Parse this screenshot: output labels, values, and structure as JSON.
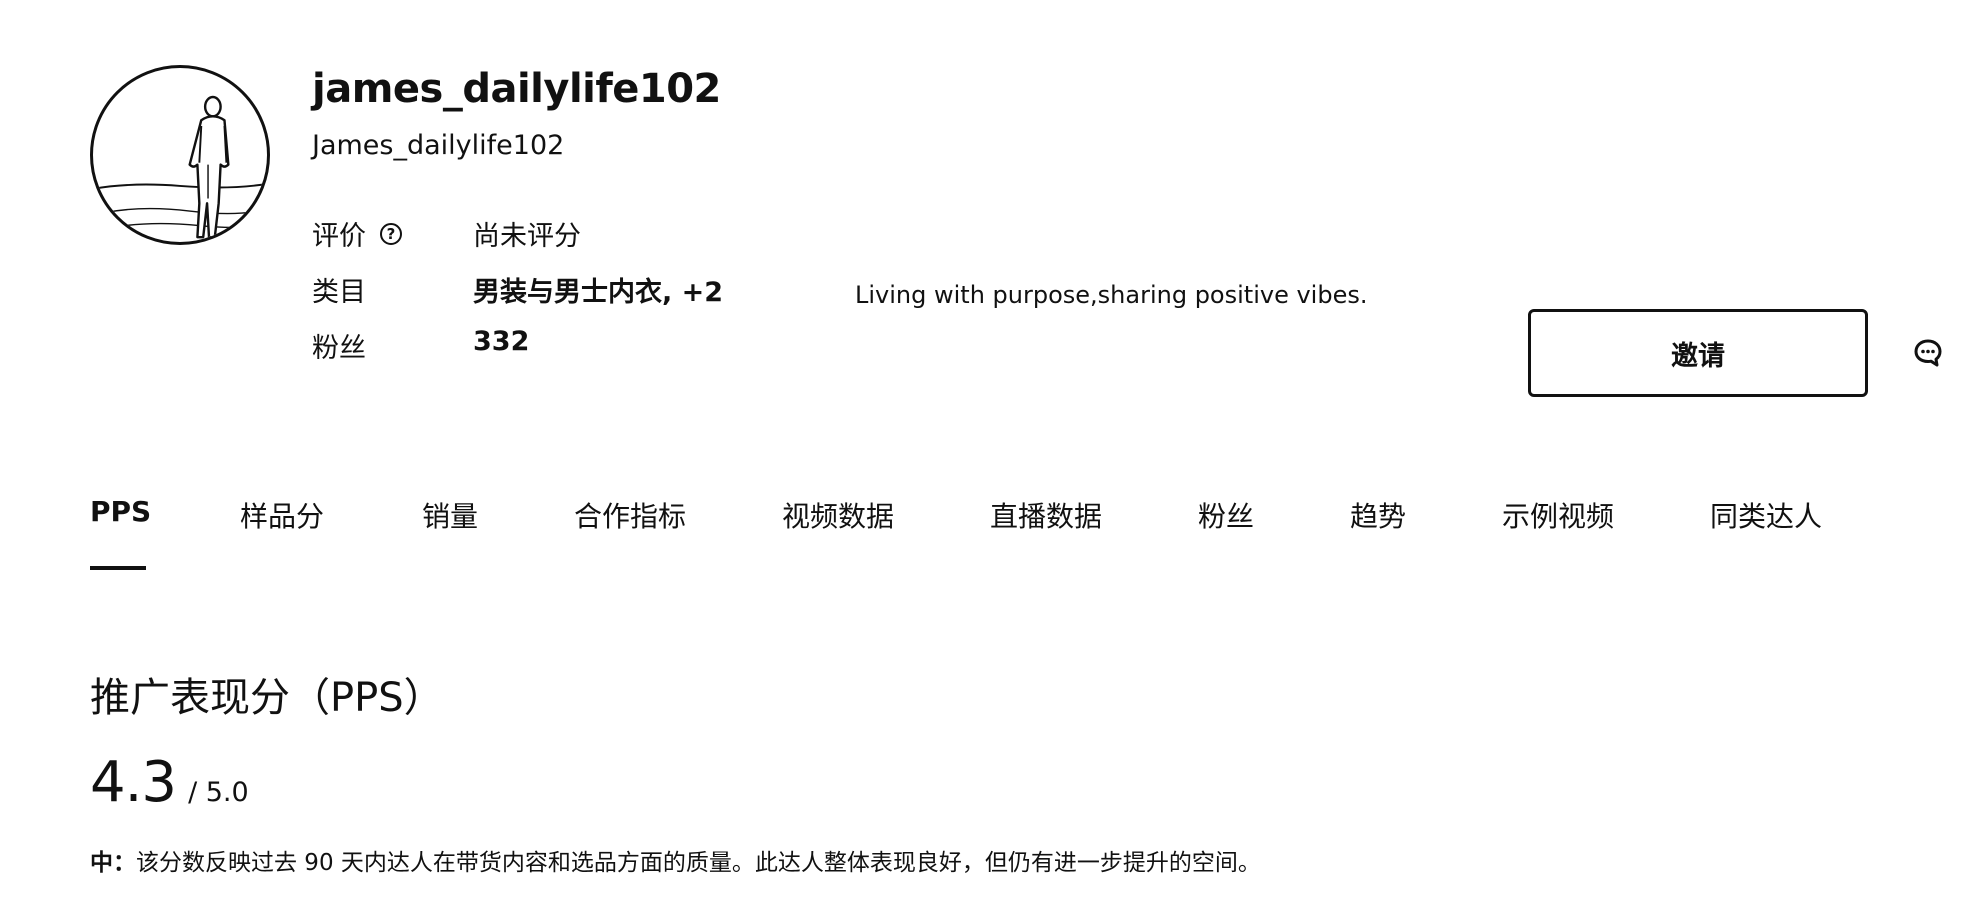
{
  "profile": {
    "username": "james_dailylife102",
    "handle": "James_dailylife102",
    "avatar_icon": "person-silhouette-avatar",
    "bio": "Living with purpose,sharing positive vibes."
  },
  "stats": {
    "rating_label": "评价",
    "rating_help_icon": "?",
    "rating_value": "尚未评分",
    "category_label": "类目",
    "category_value": "男装与男士内衣, +2",
    "fans_label": "粉丝",
    "fans_value": "332"
  },
  "actions": {
    "invite_label": "邀请",
    "message_icon": "chat-bubble-icon"
  },
  "tabs": [
    {
      "label": "PPS",
      "active": true
    },
    {
      "label": "样品分",
      "active": false
    },
    {
      "label": "销量",
      "active": false
    },
    {
      "label": "合作指标",
      "active": false
    },
    {
      "label": "视频数据",
      "active": false
    },
    {
      "label": "直播数据",
      "active": false
    },
    {
      "label": "粉丝",
      "active": false
    },
    {
      "label": "趋势",
      "active": false
    },
    {
      "label": "示例视频",
      "active": false
    },
    {
      "label": "同类达人",
      "active": false
    }
  ],
  "pps": {
    "title": "推广表现分（PPS）",
    "score": "4.3",
    "max": "/ 5.0",
    "level": "中：",
    "description": "该分数反映过去 90 天内达人在带货内容和选品方面的质量。此达人整体表现良好，但仍有进一步提升的空间。"
  }
}
